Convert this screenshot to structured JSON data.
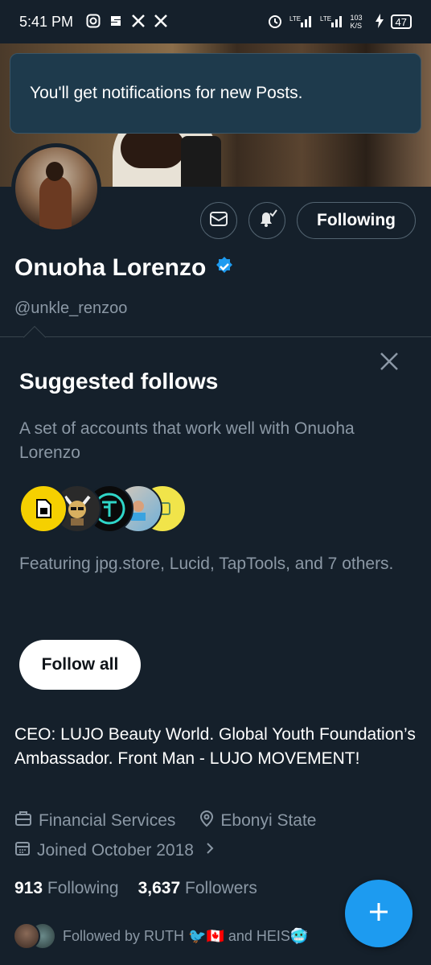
{
  "status_bar": {
    "time": "5:41 PM",
    "app_icons": [
      "instagram-icon",
      "s-icon",
      "x-icon",
      "x-icon"
    ],
    "network": "LTE",
    "speed": "103 K/S",
    "battery": "47"
  },
  "toast": {
    "message": "You'll get notifications for new Posts."
  },
  "profile": {
    "name": "Onuoha Lorenzo",
    "handle": "@unkle_renzoo",
    "verified": true,
    "following_button": "Following"
  },
  "suggested": {
    "title": "Suggested follows",
    "description": "A set of accounts that work well with Onuoha Lorenzo",
    "featuring": "Featuring jpg.store, Lucid, TapTools, and 7 others.",
    "follow_all": "Follow all"
  },
  "bio": {
    "text": "CEO: LUJO Beauty World. Global Youth Foundation’s Ambassador. Front Man - LUJO MOVEMENT!",
    "category": "Financial Services",
    "location": "Ebonyi State",
    "joined": "Joined October 2018"
  },
  "stats": {
    "following_count": "913",
    "following_label": "Following",
    "followers_count": "3,637",
    "followers_label": "Followers"
  },
  "followed_by": {
    "text": "Followed by RUTH 🐦🇨🇦 and HEIS🥶"
  },
  "colors": {
    "accent": "#1d9bf0",
    "background": "#15202b",
    "muted": "#8b98a5"
  }
}
